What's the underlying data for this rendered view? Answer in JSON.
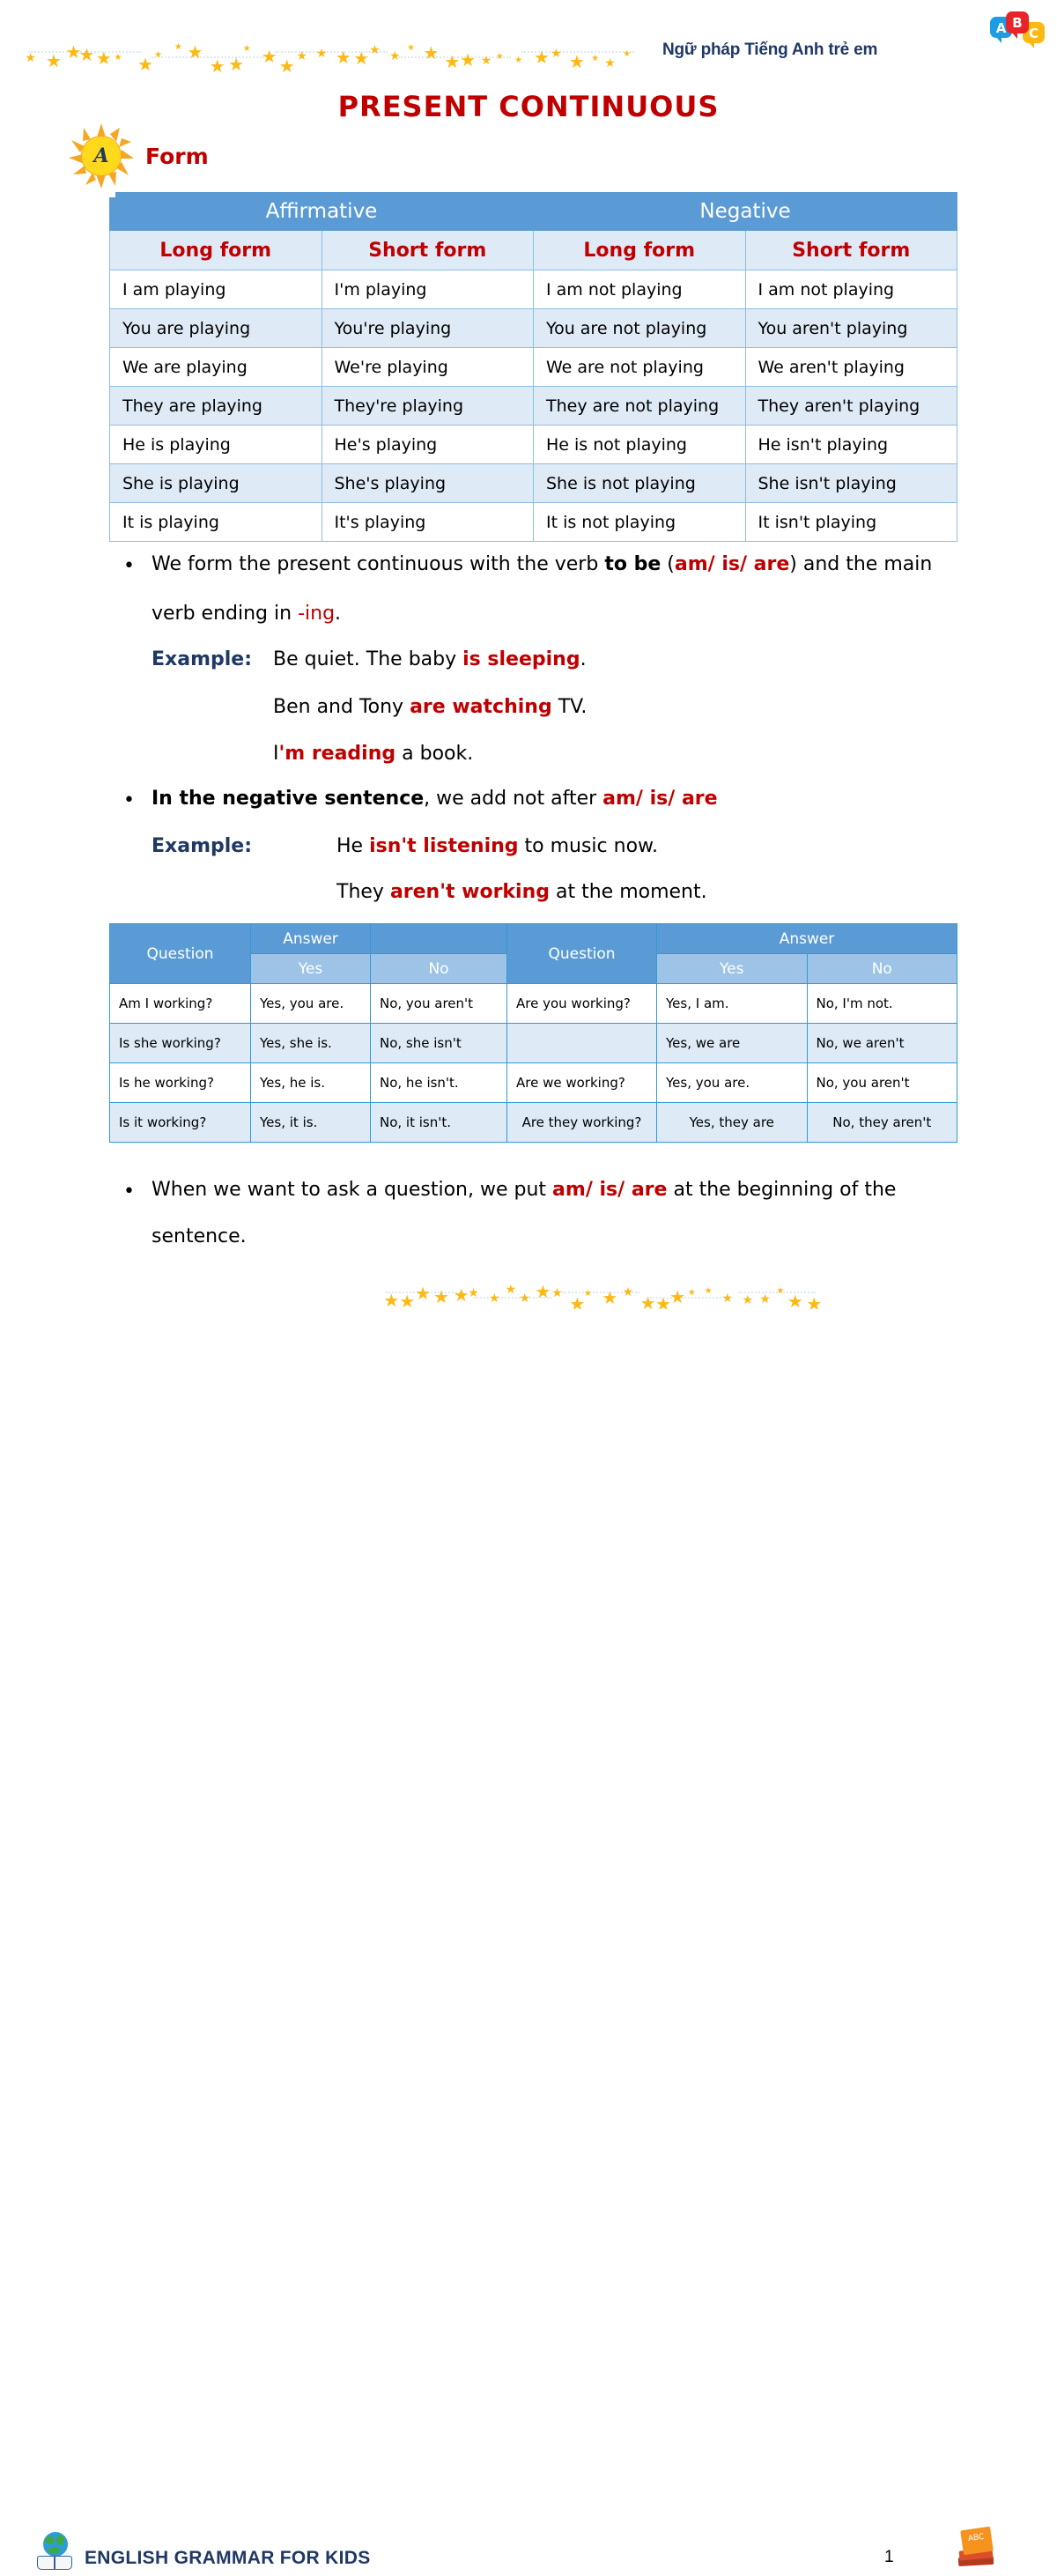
{
  "header": {
    "title": "Ngữ pháp Tiếng Anh trẻ em",
    "logo": {
      "a": "A",
      "b": "B",
      "c": "C"
    }
  },
  "doc_title": "PRESENT CONTINUOUS",
  "section": {
    "mark_letter": "A",
    "label": "Form"
  },
  "form_table": {
    "group_headers": [
      "Affirmative",
      "Negative"
    ],
    "sub_headers": [
      "Long form",
      "Short form",
      "Long form",
      "Short form"
    ],
    "rows": [
      [
        "I am playing",
        "I'm playing",
        "I am not playing",
        "I am not playing"
      ],
      [
        "You are playing",
        "You're playing",
        "You are not playing",
        "You aren't playing"
      ],
      [
        "We are playing",
        "We're playing",
        "We are not playing",
        "We aren't playing"
      ],
      [
        "They are playing",
        "They're playing",
        "They are not playing",
        "They aren't playing"
      ],
      [
        "He is playing",
        "He's playing",
        "He is not playing",
        "He isn't playing"
      ],
      [
        "She is playing",
        "She's playing",
        "She is not playing",
        "She isn't playing"
      ],
      [
        "It is playing",
        "It's playing",
        "It is not playing",
        "It isn't playing"
      ]
    ]
  },
  "notes": {
    "bullet1": {
      "dot": "•",
      "line1_a": "We form the present continuous with the verb ",
      "line1_b": "to be",
      "line1_c": " (",
      "line1_d": "am/ is/ are",
      "line1_e": ") and the main",
      "line2_a": "verb ending in ",
      "line2_b": "-ing",
      "line2_c": ".",
      "example_label": "Example:",
      "ex1_a": "Be quiet. The baby ",
      "ex1_b": "is sleeping",
      "ex1_c": ".",
      "ex2_a": "Ben and Tony ",
      "ex2_b": "are watching",
      "ex2_c": " TV.",
      "ex3_a": "I",
      "ex3_b": "'m reading",
      "ex3_c": " a book."
    },
    "bullet2": {
      "dot": "•",
      "line1_a": "In the negative sentence",
      "line1_b": ", we add not after ",
      "line1_c": "am/ is/ are",
      "example_label": "Example:",
      "ex1_a": "He ",
      "ex1_b": "isn't listening",
      "ex1_c": " to music now.",
      "ex2_a": "They ",
      "ex2_b": "aren't working",
      "ex2_c": " at the moment."
    },
    "bullet3": {
      "dot": "•",
      "line1_a": "When we want to ask a question, we put ",
      "line1_b": "am/ is/ are",
      "line1_c": " at the beginning of the",
      "line2": "sentence."
    }
  },
  "qa_table": {
    "headers": {
      "question_left": "Question",
      "answer_left": "Answer",
      "answer_left_blank": "",
      "yes_left": "Yes",
      "no_left": "No",
      "question_right": "Question",
      "answer_right": "Answer",
      "yes_right": "Yes",
      "no_right": "No"
    },
    "rows": [
      {
        "q_left": "Am I working?",
        "yes_left": "Yes, you are.",
        "no_left": "No, you aren't",
        "q_right": "Are you working?",
        "yes_right": "Yes, I am.",
        "no_right": "No, I'm not."
      },
      {
        "q_left": "Is she working?",
        "yes_left": "Yes, she is.",
        "no_left": "No, she isn't",
        "q_right": "",
        "yes_right": "Yes, we are",
        "no_right": "No, we aren't"
      },
      {
        "q_left": "Is he working?",
        "yes_left": "Yes, he is.",
        "no_left": "No, he isn't.",
        "q_right": "Are we working?",
        "yes_right": "Yes, you are.",
        "no_right": "No, you aren't"
      },
      {
        "q_left": "Is it working?",
        "yes_left": "Yes, it is.",
        "no_left": "No, it isn't.",
        "q_right": "Are they working?",
        "yes_right": "Yes, they are",
        "no_right": "No, they aren't"
      }
    ]
  },
  "footer": {
    "text": "ENGLISH GRAMMAR FOR KIDS",
    "page_number": "1",
    "books_label": "ABC"
  },
  "colors": {
    "header_blue": "#5B9BD5",
    "light_blue": "#DEEAF6",
    "mid_blue": "#9DC3E6",
    "red": "#C00000",
    "navy": "#1F3864",
    "star_yellow": "#FDB913",
    "border_blue": "#8FBEE5"
  }
}
